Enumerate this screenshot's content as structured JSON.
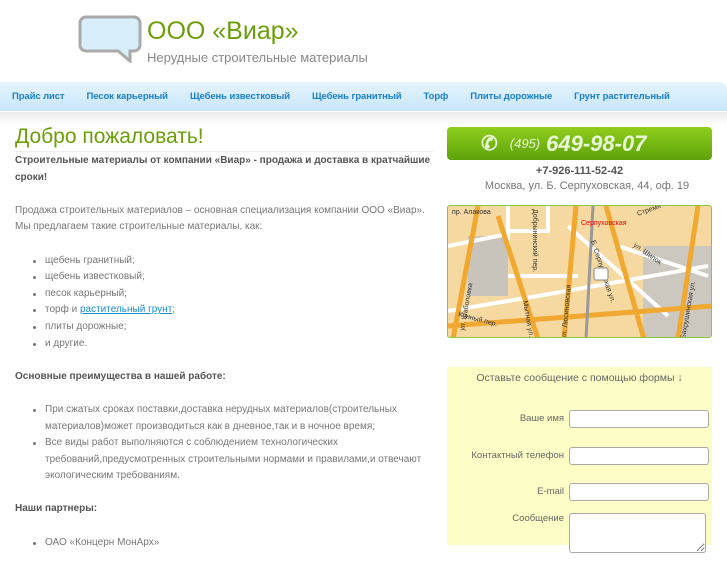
{
  "header": {
    "title": "ООО «Виар»",
    "subtitle": "Нерудные строительные материалы"
  },
  "nav": [
    "Прайс лист",
    "Песок карьерный",
    "Щебень известковый",
    "Щебень гранитный",
    "Торф",
    "Плиты дорожные",
    "Грунт растительный"
  ],
  "main": {
    "heading": "Добро пожаловать!",
    "intro_bold": "Строительные материалы от компании «Виар» - продажа и доставка в кратчайшие сроки!",
    "intro": "Продажа строительных материалов – основная специализация компании ООО «Виар». Мы предлагаем такие строительные материалы, как:",
    "materials": [
      "щебень гранитный;",
      "щебень известковый;",
      "песок карьерный;"
    ],
    "torf_prefix": "торф и ",
    "torf_link": "растительный грунт",
    "torf_suffix": ";",
    "materials2": [
      "плиты дорожные;",
      "и другие."
    ],
    "advantages_title": "Основные преимущества в нашей работе:",
    "advantages": [
      "При сжатых сроках поставки,доставка нерудных материалов(строительных материалов)может производиться как в дневное,так и в ночное время;",
      "Все виды работ выполняются с соблюдением технологических требований,предусмотренных строительными нормами и правилами,и отвечают экологическим требованиям."
    ],
    "partners_title": "Наши партнеры:",
    "partners": [
      "ОАО «Концерн МонАрх»"
    ]
  },
  "contact": {
    "phone_code": "(495)",
    "phone_number": "649-98-07",
    "phone2": "+7-926-111-52-42",
    "address": "Москва, ул. Б. Серпуховская, 44, оф. 19"
  },
  "map": {
    "labels": [
      "пр. Алакова",
      "Добрынинский пер.",
      "Серпуховская",
      "Стремя",
      "ул. Шипок",
      "ул. Шаболовка",
      "Конный пер.",
      "Мытная ул.",
      "ул. Люсиновская",
      "Б. Серпуховская ул.",
      "Бахрушинская ул."
    ]
  },
  "form": {
    "title": "Оставьте сообщение с помощью формы ↓",
    "name_label": "Ваше имя",
    "phone_label": "Контактный телефон",
    "email_label": "E-mail",
    "message_label": "Сообщение"
  },
  "colors": {
    "accent": "#6a9f0a",
    "link": "#1a7fc8",
    "form_bg": "#fdfdc6"
  }
}
